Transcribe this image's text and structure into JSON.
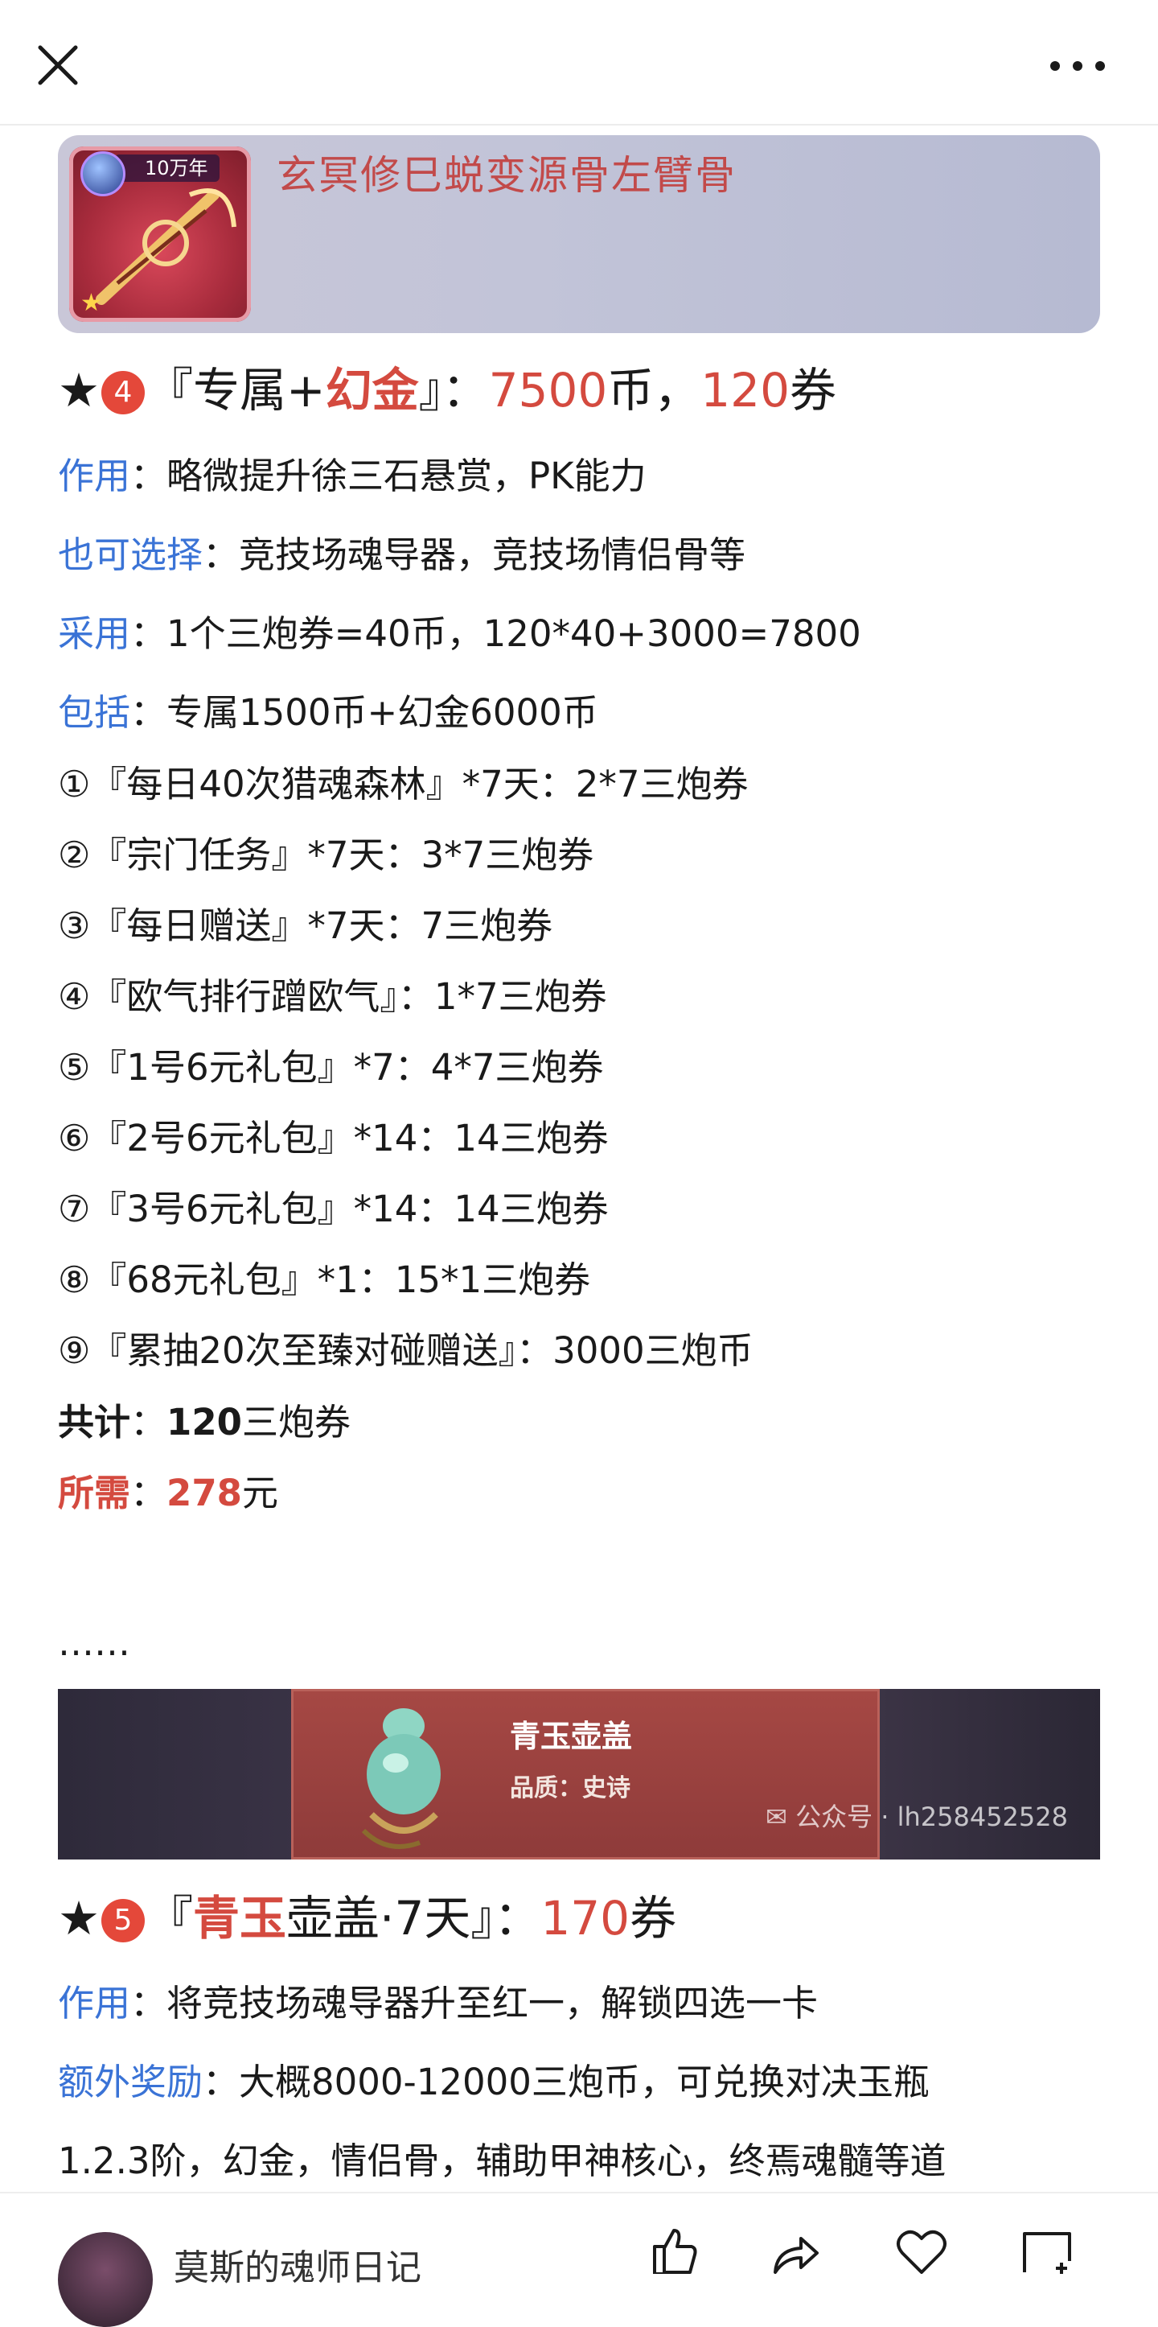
{
  "topbar": {
    "close_icon": "close-icon",
    "more_icon": "more-icon"
  },
  "banner1": {
    "badge": "10万年",
    "title": "玄冥修巳蜕变源骨左臂骨"
  },
  "section4": {
    "star": "★",
    "number": "4",
    "open_quote": "『专属+",
    "highlight": "幻金",
    "close_quote": "』：",
    "coins_value": "7500",
    "coins_unit": "币，",
    "tickets_value": "120",
    "tickets_unit": "券",
    "effect_label": "作用",
    "effect_text": "：略微提升徐三石悬赏，PK能力",
    "alt_label": "也可选择",
    "alt_text": "：竞技场魂导器，竞技场情侣骨等",
    "use_label": "采用",
    "use_text": "：1个三炮券=40币，120*40+3000=7800",
    "include_label": "包括",
    "include_text": "：专属1500币+幻金6000币",
    "items": [
      "①『每日40次猎魂森林』*7天：2*7三炮券",
      "②『宗门任务』*7天：3*7三炮券",
      "③『每日赠送』*7天：7三炮券",
      "④『欧气排行蹭欧气』：1*7三炮券",
      "⑤『1号6元礼包』*7：4*7三炮券",
      "⑥『2号6元礼包』*14：14三炮券",
      "⑦『3号6元礼包』*14：14三炮券",
      "⑧『68元礼包』*1：15*1三炮券",
      "⑨『累抽20次至臻对碰赠送』：3000三炮币"
    ],
    "total_label": "共计",
    "total_sep": "：",
    "total_value": "120",
    "total_unit": "三炮券",
    "need_label": "所需",
    "need_sep": "：",
    "need_value": "278",
    "need_unit": "元"
  },
  "ellipsis": "……",
  "banner2": {
    "item_name": "青玉壶盖",
    "item_quality": "品质：史诗",
    "watermark": "公众号 · lh258452528"
  },
  "section5": {
    "star": "★",
    "number": "5",
    "open_quote": "『",
    "highlight": "青玉",
    "rest": "壶盖·7天』：",
    "tickets_value": "170",
    "tickets_unit": "券",
    "effect_label": "作用",
    "effect_text": "：将竞技场魂导器升至红一，解锁四选一卡",
    "extra_label": "额外奖励",
    "extra_text": "：大概8000-12000三炮币，可兑换对决玉瓶",
    "extra_text_cont": "1.2.3阶，幻金，情侣骨，辅助甲神核心，终焉魂髓等道"
  },
  "bottombar": {
    "author": "莫斯的魂师日记",
    "icons": [
      "thumbs-up-icon",
      "share-icon",
      "heart-icon",
      "comment-icon"
    ]
  }
}
